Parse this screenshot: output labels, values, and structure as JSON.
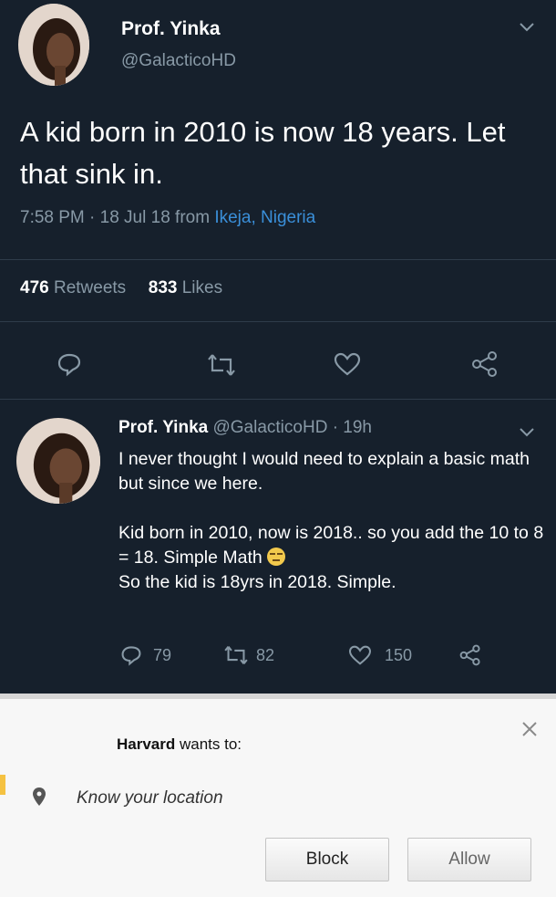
{
  "tweet": {
    "author_name": "Prof. Yinka",
    "author_handle": "@GalacticoHD",
    "text": "A kid born in 2010 is now 18 years. Let that sink in.",
    "time_date": "7:58 PM · 18 Jul 18 from ",
    "location": "Ikeja, Nigeria",
    "retweet_count": "476",
    "retweet_label": " Retweets",
    "like_count": "833",
    "like_label": " Likes"
  },
  "reply": {
    "author_name": "Prof. Yinka",
    "author_handle": "@GalacticoHD · 19h",
    "paragraph_1": "I never thought I would need to explain a basic math but since we here.",
    "paragraph_2a": "Kid born in 2010, now is 2018.. so you add the 10 to 8 = 18. Simple Math ",
    "paragraph_2b": "So the kid is 18yrs in 2018. Simple.",
    "reply_count": "79",
    "retweet_count": "82",
    "like_count": "150"
  },
  "dialog": {
    "site": "Harvard",
    "title_suffix": " wants to:",
    "permission": "Know your location",
    "block_label": "Block",
    "allow_label": "Allow"
  },
  "colors": {
    "background": "#16202c",
    "link": "#3a8fd9",
    "muted": "#8899a6"
  }
}
